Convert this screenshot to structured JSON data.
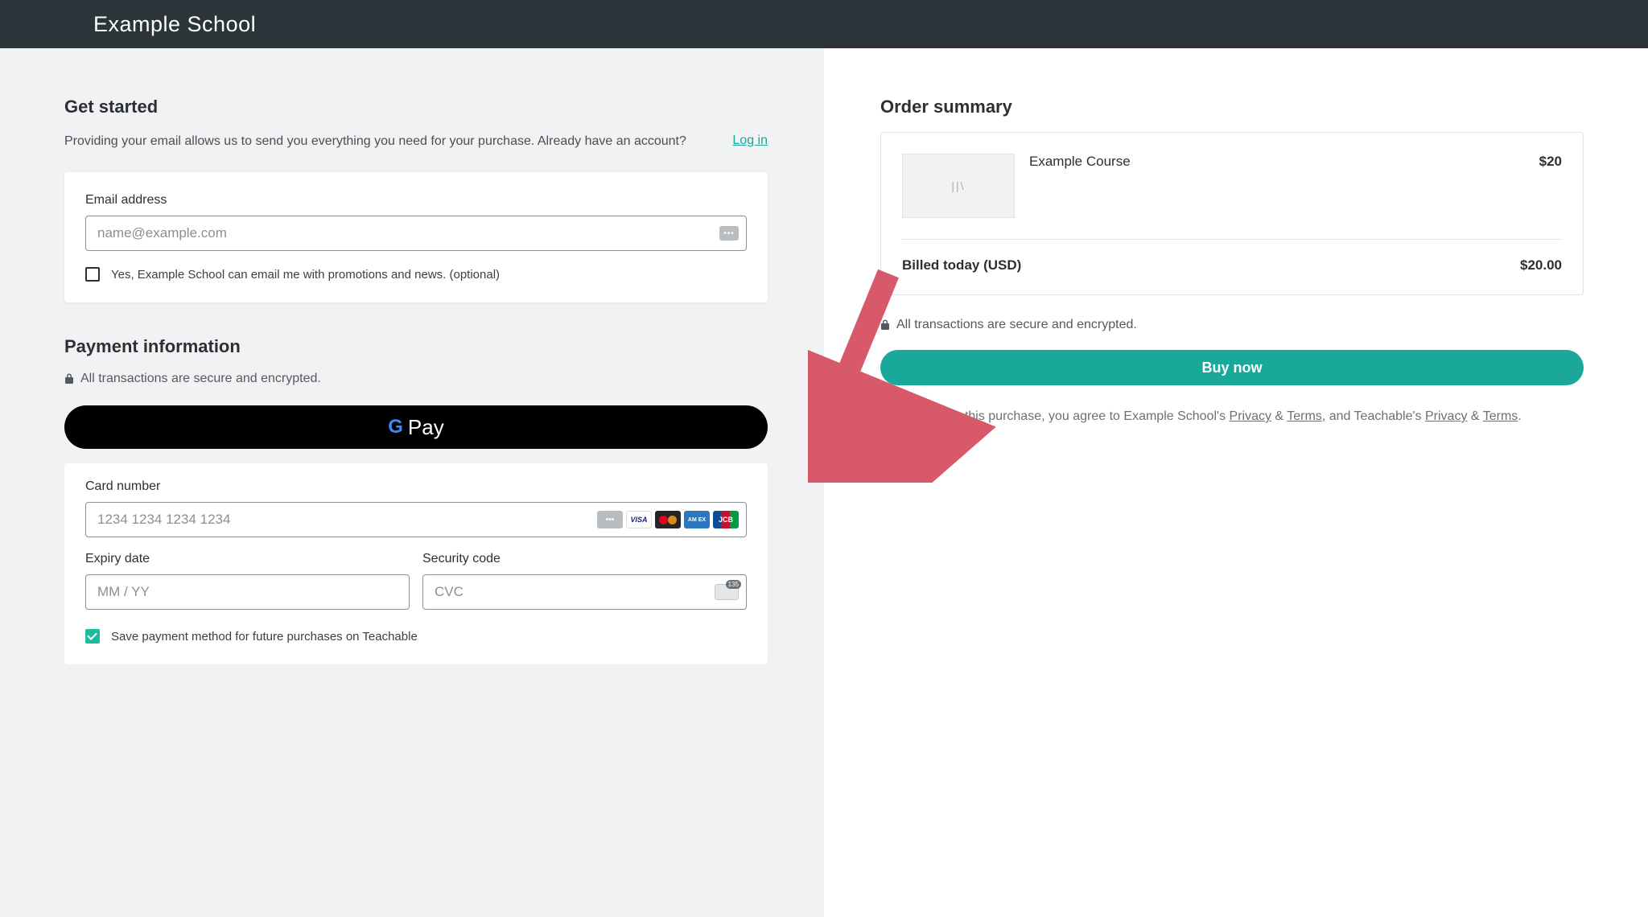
{
  "header": {
    "title": "Example School"
  },
  "getStarted": {
    "heading": "Get started",
    "subtext": "Providing your email allows us to send you everything you need for your purchase. Already have an account?",
    "loginLabel": "Log in",
    "emailLabel": "Email address",
    "emailPlaceholder": "name@example.com",
    "promoCheckboxLabel": "Yes, Example School can email me with promotions and news. (optional)"
  },
  "payment": {
    "heading": "Payment information",
    "secureText": "All transactions are secure and encrypted.",
    "gpayLabel": "Pay",
    "cardNumberLabel": "Card number",
    "cardNumberPlaceholder": "1234 1234 1234 1234",
    "expiryLabel": "Expiry date",
    "expiryPlaceholder": "MM / YY",
    "cvcLabel": "Security code",
    "cvcPlaceholder": "CVC",
    "saveLabel": "Save payment method for future purchases on Teachable"
  },
  "summary": {
    "heading": "Order summary",
    "itemName": "Example Course",
    "itemPrice": "$20",
    "totalLabel": "Billed today (USD)",
    "totalValue": "$20.00",
    "secureText": "All transactions are secure and encrypted.",
    "buyLabel": "Buy now",
    "legal": {
      "prefix": "By completing this purchase, you agree to Example School's ",
      "privacy1": "Privacy",
      "amp": " & ",
      "terms1": "Terms",
      "middle": ", and Teachable's ",
      "privacy2": "Privacy",
      "terms2": "Terms",
      "suffix": "."
    }
  }
}
